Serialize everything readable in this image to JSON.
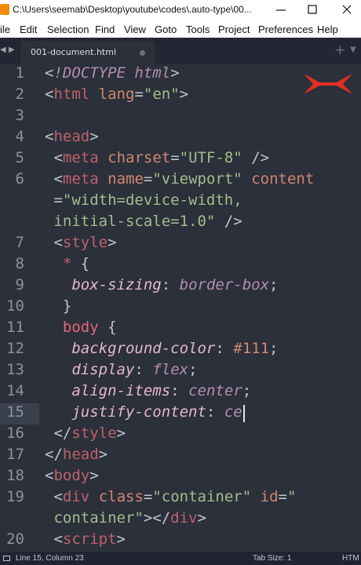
{
  "window": {
    "title": "C:\\Users\\seemab\\Desktop\\youtube\\codes\\.auto-type\\00..."
  },
  "menu": [
    "ile",
    "Edit",
    "Selection",
    "Find",
    "View",
    "Goto",
    "Tools",
    "Project",
    "Preferences",
    "Help"
  ],
  "tab": {
    "label": "001-document.html"
  },
  "lines": [
    {
      "n": "1",
      "segs": [
        [
          "c-punct",
          "<"
        ],
        [
          "c-kw",
          "!DOCTYPE"
        ],
        [
          "c-plain",
          " "
        ],
        [
          "c-kw",
          "html"
        ],
        [
          "c-punct",
          ">"
        ]
      ]
    },
    {
      "n": "2",
      "segs": [
        [
          "c-punct",
          "<"
        ],
        [
          "c-tag",
          "html"
        ],
        [
          "c-plain",
          " "
        ],
        [
          "c-attr",
          "lang"
        ],
        [
          "c-punct",
          "="
        ],
        [
          "c-str",
          "\"en\""
        ],
        [
          "c-punct",
          ">"
        ]
      ]
    },
    {
      "n": "3",
      "segs": []
    },
    {
      "n": "4",
      "segs": [
        [
          "c-punct",
          "<"
        ],
        [
          "c-tag",
          "head"
        ],
        [
          "c-punct",
          ">"
        ]
      ]
    },
    {
      "n": "5",
      "segs": [
        [
          "c-plain",
          " "
        ],
        [
          "c-punct",
          "<"
        ],
        [
          "c-tag",
          "meta"
        ],
        [
          "c-plain",
          " "
        ],
        [
          "c-attr",
          "charset"
        ],
        [
          "c-punct",
          "="
        ],
        [
          "c-str",
          "\"UTF-8\""
        ],
        [
          "c-plain",
          " "
        ],
        [
          "c-punct",
          "/>"
        ]
      ]
    },
    {
      "n": "6",
      "segs": [
        [
          "c-plain",
          " "
        ],
        [
          "c-punct",
          "<"
        ],
        [
          "c-tag",
          "meta"
        ],
        [
          "c-plain",
          " "
        ],
        [
          "c-attr",
          "name"
        ],
        [
          "c-punct",
          "="
        ],
        [
          "c-str",
          "\"viewport\""
        ],
        [
          "c-plain",
          " "
        ],
        [
          "c-attr",
          "content"
        ]
      ]
    },
    {
      "n": "",
      "segs": [
        [
          "c-plain",
          " "
        ],
        [
          "c-punct",
          "="
        ],
        [
          "c-str",
          "\"width=device-width,"
        ]
      ]
    },
    {
      "n": "",
      "segs": [
        [
          "c-plain",
          " "
        ],
        [
          "c-str",
          "initial-scale=1.0\""
        ],
        [
          "c-plain",
          " "
        ],
        [
          "c-punct",
          "/>"
        ]
      ]
    },
    {
      "n": "7",
      "segs": [
        [
          "c-plain",
          " "
        ],
        [
          "c-punct",
          "<"
        ],
        [
          "c-tag",
          "style"
        ],
        [
          "c-punct",
          ">"
        ]
      ]
    },
    {
      "n": "8",
      "segs": [
        [
          "c-plain",
          "  "
        ],
        [
          "c-sel",
          "*"
        ],
        [
          "c-plain",
          " "
        ],
        [
          "c-punct",
          "{"
        ]
      ]
    },
    {
      "n": "9",
      "segs": [
        [
          "c-plain",
          "   "
        ],
        [
          "c-prop",
          "box-sizing"
        ],
        [
          "c-punct",
          ":"
        ],
        [
          "c-plain",
          " "
        ],
        [
          "c-val",
          "border-box"
        ],
        [
          "c-punct",
          ";"
        ]
      ]
    },
    {
      "n": "10",
      "segs": [
        [
          "c-plain",
          "  "
        ],
        [
          "c-punct",
          "}"
        ]
      ]
    },
    {
      "n": "11",
      "segs": [
        [
          "c-plain",
          "  "
        ],
        [
          "c-tag2",
          "body"
        ],
        [
          "c-plain",
          " "
        ],
        [
          "c-punct",
          "{"
        ]
      ]
    },
    {
      "n": "12",
      "segs": [
        [
          "c-plain",
          "   "
        ],
        [
          "c-prop",
          "background-color"
        ],
        [
          "c-punct",
          ":"
        ],
        [
          "c-plain",
          " "
        ],
        [
          "c-num",
          "#111"
        ],
        [
          "c-punct",
          ";"
        ]
      ]
    },
    {
      "n": "13",
      "segs": [
        [
          "c-plain",
          "   "
        ],
        [
          "c-prop",
          "display"
        ],
        [
          "c-punct",
          ":"
        ],
        [
          "c-plain",
          " "
        ],
        [
          "c-val",
          "flex"
        ],
        [
          "c-punct",
          ";"
        ]
      ]
    },
    {
      "n": "14",
      "segs": [
        [
          "c-plain",
          "   "
        ],
        [
          "c-prop",
          "align-items"
        ],
        [
          "c-punct",
          ":"
        ],
        [
          "c-plain",
          " "
        ],
        [
          "c-val",
          "center"
        ],
        [
          "c-punct",
          ";"
        ]
      ]
    },
    {
      "n": "15",
      "segs": [
        [
          "c-plain",
          "   "
        ],
        [
          "c-prop",
          "justify-content"
        ],
        [
          "c-punct",
          ":"
        ],
        [
          "c-plain",
          " "
        ],
        [
          "c-val",
          "ce"
        ]
      ]
    },
    {
      "n": "16",
      "segs": [
        [
          "c-plain",
          " "
        ],
        [
          "c-punct",
          "</"
        ],
        [
          "c-tag",
          "style"
        ],
        [
          "c-punct",
          ">"
        ]
      ]
    },
    {
      "n": "17",
      "segs": [
        [
          "c-punct",
          "</"
        ],
        [
          "c-tag",
          "head"
        ],
        [
          "c-punct",
          ">"
        ]
      ]
    },
    {
      "n": "18",
      "segs": [
        [
          "c-punct",
          "<"
        ],
        [
          "c-tag",
          "body"
        ],
        [
          "c-punct",
          ">"
        ]
      ]
    },
    {
      "n": "19",
      "segs": [
        [
          "c-plain",
          " "
        ],
        [
          "c-punct",
          "<"
        ],
        [
          "c-tag",
          "div"
        ],
        [
          "c-plain",
          " "
        ],
        [
          "c-attr",
          "class"
        ],
        [
          "c-punct",
          "="
        ],
        [
          "c-str",
          "\"container\""
        ],
        [
          "c-plain",
          " "
        ],
        [
          "c-attr",
          "id"
        ],
        [
          "c-punct",
          "="
        ],
        [
          "c-str",
          "\""
        ]
      ]
    },
    {
      "n": "",
      "segs": [
        [
          "c-plain",
          " "
        ],
        [
          "c-str",
          "container\""
        ],
        [
          "c-punct",
          "></"
        ],
        [
          "c-tag",
          "div"
        ],
        [
          "c-punct",
          ">"
        ]
      ]
    },
    {
      "n": "20",
      "segs": [
        [
          "c-plain",
          " "
        ],
        [
          "c-punct",
          "<"
        ],
        [
          "c-tag",
          "script"
        ],
        [
          "c-punct",
          ">"
        ]
      ]
    }
  ],
  "status": {
    "position": "Line 15, Column 23",
    "tab_size": "Tab Size: 1",
    "syntax": "HTM"
  },
  "colors": {
    "editor_bg": "#2b303b",
    "logo": "#e03020"
  },
  "icons": [
    "sublime-icon",
    "minimize-icon",
    "maximize-icon",
    "close-icon",
    "logo-icon"
  ]
}
